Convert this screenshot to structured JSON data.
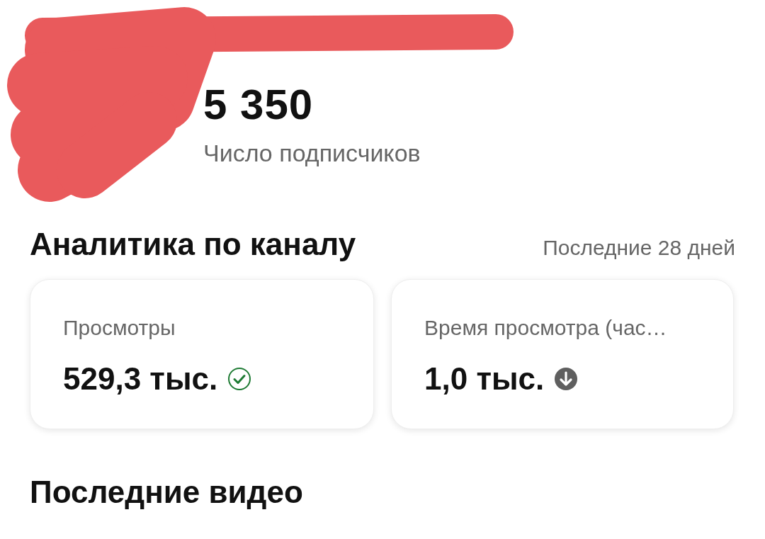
{
  "profile": {
    "subscriber_count": "5 350",
    "subscriber_label": "Число подписчиков"
  },
  "analytics": {
    "title": "Аналитика по каналу",
    "period": "Последние 28 дней",
    "cards": [
      {
        "label": "Просмотры",
        "value": "529,3 тыс.",
        "kind": "ok"
      },
      {
        "label": "Время просмотра (час…",
        "value": "1,0 тыс.",
        "kind": "down"
      }
    ]
  },
  "recent_videos": {
    "title": "Последние видео"
  }
}
